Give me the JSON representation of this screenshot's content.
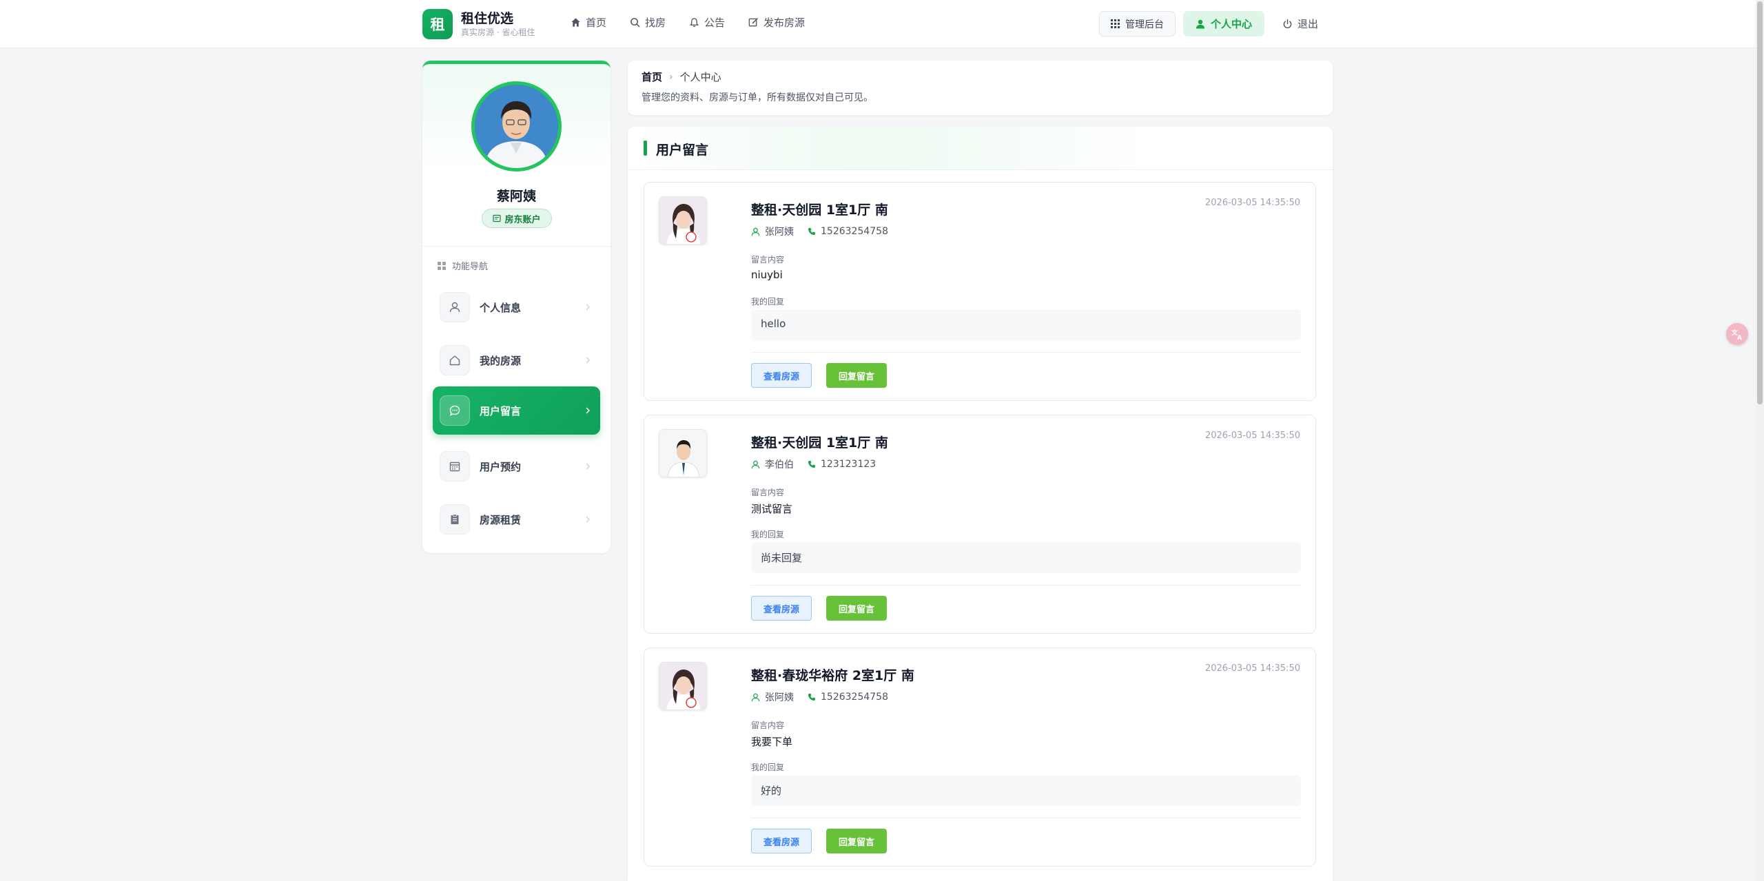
{
  "brand": {
    "logo_char": "租",
    "name": "租住优选",
    "tagline": "真实房源 · 省心租住"
  },
  "nav": {
    "links": [
      {
        "label": "首页",
        "icon": "home-icon"
      },
      {
        "label": "找房",
        "icon": "search-icon"
      },
      {
        "label": "公告",
        "icon": "bell-icon"
      },
      {
        "label": "发布房源",
        "icon": "edit-icon"
      }
    ],
    "admin_label": "管理后台",
    "center_label": "个人中心",
    "logout_label": "退出"
  },
  "profile": {
    "name": "蔡阿姨",
    "role": "房东账户"
  },
  "menu": {
    "title": "功能导航",
    "items": [
      {
        "label": "个人信息",
        "icon": "user-icon",
        "active": false
      },
      {
        "label": "我的房源",
        "icon": "house-icon",
        "active": false
      },
      {
        "label": "用户留言",
        "icon": "message-icon",
        "active": true
      },
      {
        "label": "用户预约",
        "icon": "calendar-icon",
        "active": false
      },
      {
        "label": "房源租赁",
        "icon": "clipboard-icon",
        "active": false
      }
    ]
  },
  "breadcrumb": {
    "home": "首页",
    "current": "个人中心",
    "description": "管理您的资料、房源与订单，所有数据仅对自己可见。"
  },
  "panel": {
    "title": "用户留言",
    "content_label": "留言内容",
    "reply_label": "我的回复",
    "view_button": "查看房源",
    "reply_button": "回复留言"
  },
  "messages": [
    {
      "title": "整租·天创园 1室1厅 南",
      "time": "2026-03-05 14:35:50",
      "user": "张阿姨",
      "phone": "15263254758",
      "content": "niuybi",
      "reply": "hello"
    },
    {
      "title": "整租·天创园 1室1厅 南",
      "time": "2026-03-05 14:35:50",
      "user": "李伯伯",
      "phone": "123123123",
      "content": "测试留言",
      "reply": "尚未回复"
    },
    {
      "title": "整租·春珑华裕府 2室1厅 南",
      "time": "2026-03-05 14:35:50",
      "user": "张阿姨",
      "phone": "15263254758",
      "content": "我要下单",
      "reply": "好的"
    }
  ],
  "colors": {
    "accent": "#16a34a",
    "accent_light": "#dff5e8",
    "view_button": "#3b82f6",
    "reply_button": "#67c23a"
  }
}
